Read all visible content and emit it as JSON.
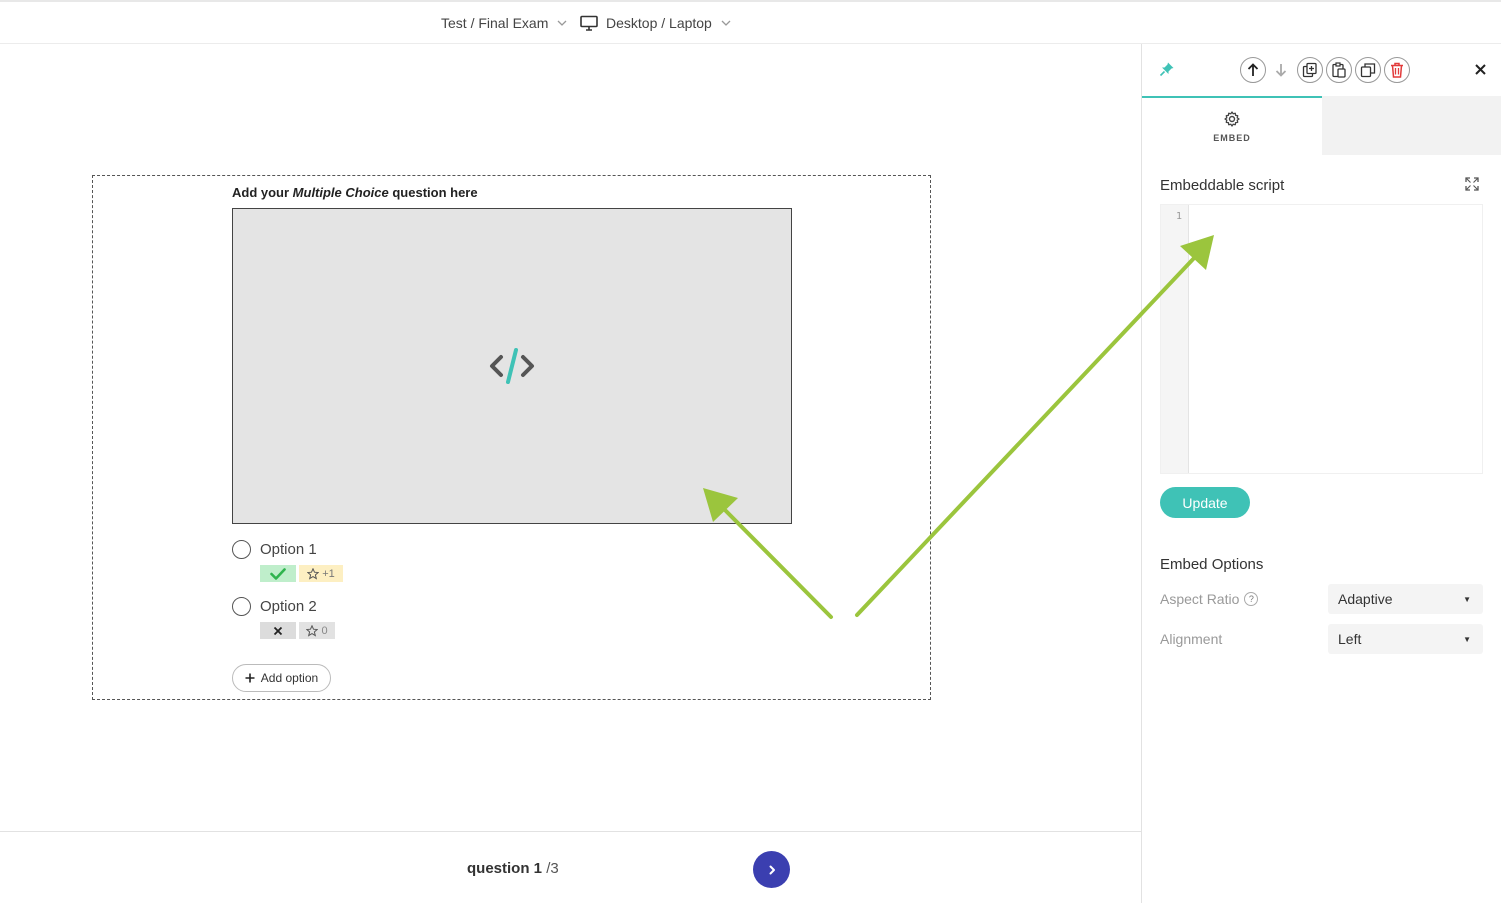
{
  "topbar": {
    "breadcrumb": "Test / Final Exam",
    "device": "Desktop / Laptop"
  },
  "question": {
    "title_prefix": "Add your ",
    "title_type": "Multiple Choice",
    "title_suffix": " question here",
    "options": [
      {
        "label": "Option 1",
        "score": "+1",
        "correct": true
      },
      {
        "label": "Option 2",
        "score": "0",
        "correct": false
      }
    ],
    "add_option_label": "Add option"
  },
  "footer": {
    "question_label": "question 1",
    "total": "/3"
  },
  "panel": {
    "tab_label": "EMBED",
    "embeddable_script_title": "Embeddable script",
    "editor_line_number": "1",
    "update_label": "Update",
    "embed_options_title": "Embed Options",
    "aspect_ratio_label": "Aspect Ratio",
    "aspect_ratio_value": "Adaptive",
    "alignment_label": "Alignment",
    "alignment_value": "Left",
    "help_glyph": "?"
  },
  "colors": {
    "accent": "#3fc2b6",
    "next_button": "#3b3fb0",
    "delete_icon": "#e23b3b",
    "annotation_arrow": "#9bc53d"
  },
  "icons": [
    "chevron-down-icon",
    "monitor-icon",
    "pin-icon",
    "arrow-up-icon",
    "arrow-down-icon",
    "duplicate-icon",
    "paste-icon",
    "copy-icon",
    "trash-icon",
    "close-icon",
    "gear-icon",
    "expand-icon",
    "code-icon",
    "check-icon",
    "x-icon",
    "star-icon",
    "plus-icon",
    "chevron-right-icon"
  ]
}
